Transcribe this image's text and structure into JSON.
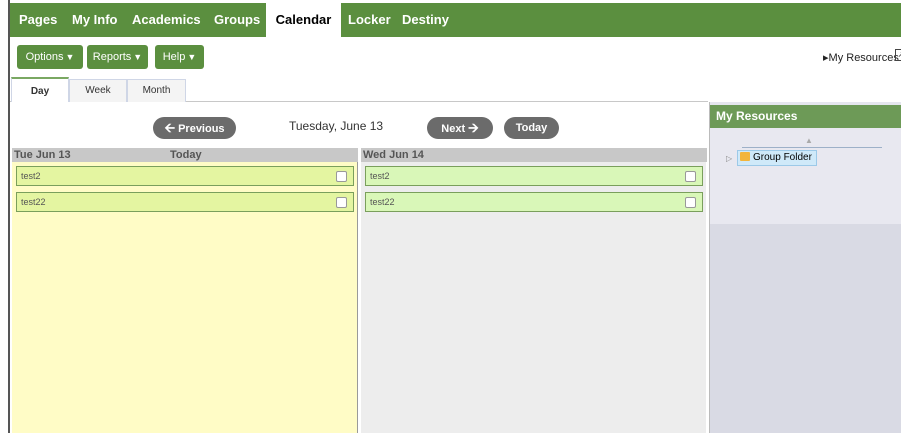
{
  "topnav": {
    "items": [
      "Pages",
      "My Info",
      "Academics",
      "Groups",
      "Calendar",
      "Locker",
      "Destiny"
    ],
    "active": "Calendar"
  },
  "toolbar": {
    "options_label": "Options",
    "reports_label": "Reports",
    "help_label": "Help",
    "my_resources_link": "My Resources"
  },
  "tabs": [
    "Day",
    "Week",
    "Month"
  ],
  "active_tab": "Day",
  "calendar": {
    "previous_label": "Previous",
    "next_label": "Next",
    "today_label": "Today",
    "current_date": "Tuesday, June 13",
    "columns": [
      {
        "date": "Tue Jun 13",
        "badge": "Today",
        "events": [
          "test2",
          "test22"
        ]
      },
      {
        "date": "Wed Jun 14",
        "badge": "",
        "events": [
          "test2",
          "test22"
        ]
      }
    ]
  },
  "resources_panel": {
    "title": "My Resources",
    "folder_label": "Group Folder"
  },
  "colors": {
    "nav_green": "#5b8f3f",
    "today_column": "#fffcc6",
    "event_green": "#e4f5a1",
    "panel_header": "#6d9a57"
  }
}
